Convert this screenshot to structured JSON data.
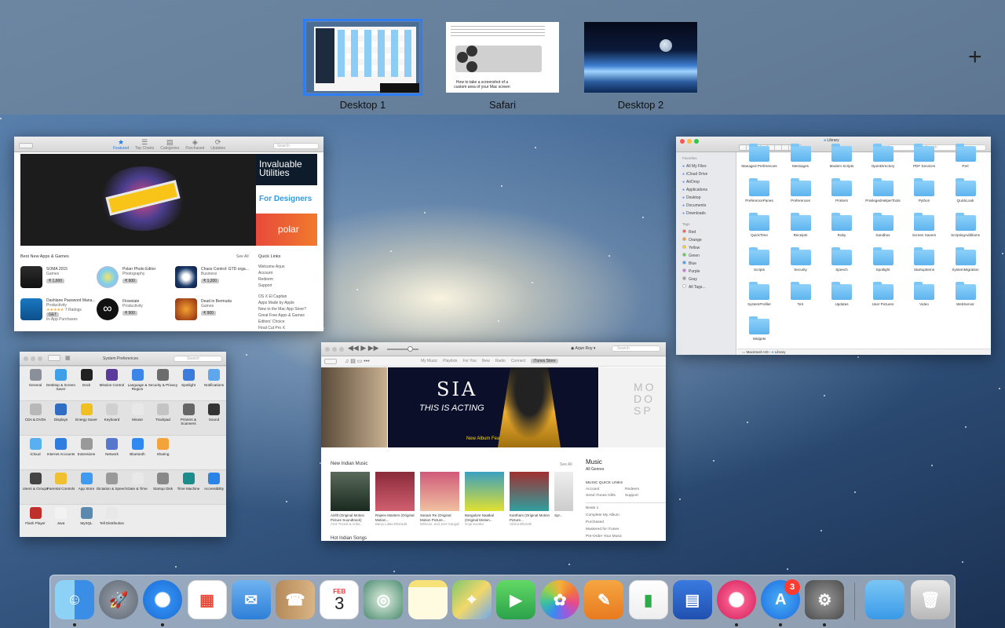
{
  "spaces": [
    {
      "label": "Desktop 1"
    },
    {
      "label": "Safari"
    },
    {
      "label": "Desktop 2"
    }
  ],
  "safari_thumb": {
    "caption": "How to take a screenshot of a custom area of your Mac screen"
  },
  "add_space": "+",
  "appstore": {
    "toolbar": [
      "Featured",
      "Top Charts",
      "Categories",
      "Purchased",
      "Updates"
    ],
    "search_placeholder": "Search",
    "banner": {
      "title": "Invaluable Utilities",
      "designers": "For Designers",
      "polar": "polar"
    },
    "section": "Best New Apps & Games",
    "see_all": "See All",
    "apps": [
      {
        "name": "SOMA 2015",
        "cat": "Games",
        "price": "₹ 1,600"
      },
      {
        "name": "Polarr Photo Editor",
        "cat": "Photography",
        "price": "₹ 600"
      },
      {
        "name": "Chaos Control: GTD orga...",
        "cat": "Business",
        "price": "₹ 1,200"
      },
      {
        "name": "Dashlane Password Mana...",
        "cat": "Productivity",
        "price": "GET",
        "extra": "In-App Purchases",
        "rating": "7 Ratings"
      },
      {
        "name": "Flowstate",
        "cat": "Productivity",
        "price": "₹ 900"
      },
      {
        "name": "Dead in Bermuda",
        "cat": "Games",
        "price": "₹ 900"
      }
    ],
    "quick_links_title": "Quick Links",
    "quick_links": [
      "Welcome Arjun",
      "Account",
      "Redeem",
      "Support"
    ],
    "more_links": [
      "OS X El Capitan",
      "Apps Made by Apple",
      "New to the Mac App Store?",
      "Great Free Apps & Games",
      "Editors' Choice",
      "Final Cut Pro X",
      "Logic Pro X"
    ]
  },
  "finder": {
    "title": "Library",
    "search": "Search",
    "favorites_header": "Favorites",
    "favorites": [
      "All My Files",
      "iCloud Drive",
      "AirDrop",
      "Applications",
      "Desktop",
      "Documents",
      "Downloads"
    ],
    "tags_header": "Tags",
    "tags": [
      {
        "name": "Red",
        "color": "#fc5753"
      },
      {
        "name": "Orange",
        "color": "#fd9b33"
      },
      {
        "name": "Yellow",
        "color": "#fdd12f"
      },
      {
        "name": "Green",
        "color": "#5ec94b"
      },
      {
        "name": "Blue",
        "color": "#3f9ffd"
      },
      {
        "name": "Purple",
        "color": "#c77cdd"
      },
      {
        "name": "Gray",
        "color": "#9a9a9a"
      },
      {
        "name": "All Tags...",
        "color": "#ffffff"
      }
    ],
    "folders": [
      "Managed Preferences",
      "Messages",
      "Modem Scripts",
      "OpenDirectory",
      "PDF Services",
      "Perl",
      "PreferencePanes",
      "Preferences",
      "Printers",
      "PrivilegedHelperTools",
      "Python",
      "QuickLook",
      "QuickTime",
      "Receipts",
      "Ruby",
      "Sandbox",
      "Screen Savers",
      "ScriptingAdditions",
      "Scripts",
      "Security",
      "Speech",
      "Spotlight",
      "StartupItems",
      "SystemMigration",
      "SystemProfiler",
      "TeX",
      "Updates",
      "User Pictures",
      "Video",
      "WebServer",
      "Widgets"
    ],
    "path": [
      "Macintosh HD",
      "Library"
    ]
  },
  "sysprefs": {
    "title": "System Preferences",
    "search": "Search",
    "rows": [
      [
        "General",
        "Desktop & Screen Saver",
        "Dock",
        "Mission Control",
        "Language & Region",
        "Security & Privacy",
        "Spotlight",
        "Notifications"
      ],
      [
        "CDs & DVDs",
        "Displays",
        "Energy Saver",
        "Keyboard",
        "Mouse",
        "Trackpad",
        "Printers & Scanners",
        "Sound"
      ],
      [
        "iCloud",
        "Internet Accounts",
        "Extensions",
        "Network",
        "Bluetooth",
        "Sharing"
      ],
      [
        "Users & Groups",
        "Parental Controls",
        "App Store",
        "Dictation & Speech",
        "Date & Time",
        "Startup Disk",
        "Time Machine",
        "Accessibility"
      ],
      [
        "Flash Player",
        "Java",
        "MySQL",
        "Tell Distribution"
      ]
    ]
  },
  "itunes": {
    "user": "Arjun Roy",
    "search": "Search",
    "nav": [
      "My Music",
      "Playlists",
      "For You",
      "New",
      "Radio",
      "Connect",
      "iTunes Store"
    ],
    "banner_artist": "SIA",
    "banner_album": "THIS IS ACTING",
    "banner_sub": "New Album Feat. 'Alive'",
    "side_text": "MO DO SP",
    "section": "New Indian Music",
    "see_all": "See All",
    "albums": [
      {
        "title": "Airlift (Original Motion Picture Soundtrack)",
        "artist": "Amit Trivedi & Ankit..."
      },
      {
        "title": "Rajeev Masters (Original Motion...",
        "artist": "Banjo Lalaa Bharadd"
      },
      {
        "title": "Sanam Re (Original Motion Picture...",
        "artist": "Mithoon, and Jeet Ganguli"
      },
      {
        "title": "Bangalore Naatkal (Original Motion...",
        "artist": "Gopi Sundar"
      },
      {
        "title": "Kantham (Original Motion Picture...",
        "artist": "Ulisha Bharath"
      },
      {
        "title": "Spr...",
        "artist": ""
      }
    ],
    "music_title": "Music",
    "all_genres": "All Genres",
    "quick_links_title": "MUSIC QUICK LINKS",
    "quick_links": [
      "Account",
      "Redeem",
      "Send iTunes Gifts",
      "Support"
    ],
    "more": [
      "Beats 1",
      "Complete My Album",
      "Purchased",
      "Mastered for iTunes",
      "Pre-Order Your Music"
    ],
    "next_section": "Hot Indian Songs"
  },
  "dock": {
    "items": [
      "finder-icon",
      "launchpad-icon",
      "safari-icon",
      "grid-app-icon",
      "mail-icon",
      "contacts-icon",
      "calendar-icon",
      "preview-icon",
      "notes-icon",
      "maps-icon",
      "facetime-icon",
      "photos-icon",
      "pages-icon",
      "numbers-icon",
      "keynote-icon",
      "itunes-icon",
      "app-store-icon",
      "system-preferences-icon",
      "downloads-folder-icon",
      "trash-icon"
    ],
    "calendar_month": "FEB",
    "calendar_day": "3",
    "app_store_badge": "3"
  }
}
